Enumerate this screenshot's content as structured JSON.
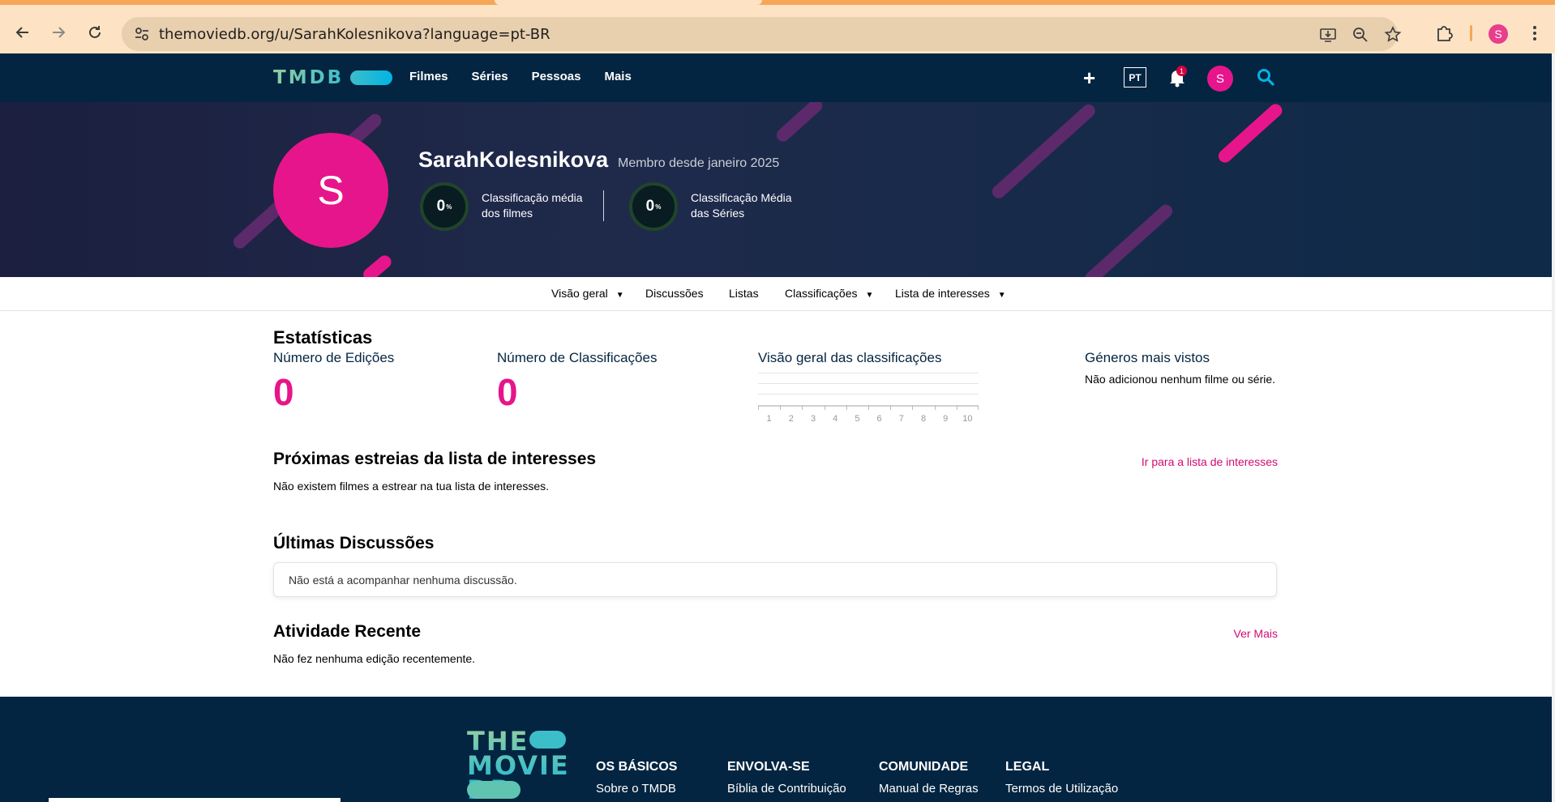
{
  "browser": {
    "url": "themoviedb.org/u/SarahKolesnikova?language=pt-BR",
    "profile_initial": "S"
  },
  "header": {
    "logo": "TMDB",
    "nav": [
      "Filmes",
      "Séries",
      "Pessoas",
      "Mais"
    ],
    "language": "PT",
    "notification_count": "1",
    "avatar_initial": "S"
  },
  "profile": {
    "avatar_initial": "S",
    "username": "SarahKolesnikova",
    "member_since": "Membro desde janeiro 2025",
    "movie_score": "0",
    "movie_score_label_1": "Classificação média",
    "movie_score_label_2": "dos filmes",
    "tv_score": "0",
    "tv_score_label_1": "Classificação Média",
    "tv_score_label_2": "das Séries",
    "score_unit": "%"
  },
  "sub_nav": {
    "overview": "Visão geral",
    "discussions": "Discussões",
    "lists": "Listas",
    "ratings": "Classificações",
    "watchlist": "Lista de interesses"
  },
  "stats": {
    "heading": "Estatísticas",
    "edits_label": "Número de Edições",
    "edits_value": "0",
    "ratings_label": "Número de Classificações",
    "ratings_value": "0",
    "overview_label": "Visão geral das classificações",
    "genres_label": "Géneros mais vistos",
    "genres_text": "Não adicionou nenhum filme ou série."
  },
  "chart_data": {
    "type": "bar",
    "categories": [
      "1",
      "2",
      "3",
      "4",
      "5",
      "6",
      "7",
      "8",
      "9",
      "10"
    ],
    "values": [
      0,
      0,
      0,
      0,
      0,
      0,
      0,
      0,
      0,
      0
    ],
    "title": "Visão geral das classificações"
  },
  "upcoming": {
    "heading": "Próximas estreias da lista de interesses",
    "link": "Ir para a lista de interesses",
    "text": "Não existem filmes a estrear na tua lista de interesses."
  },
  "discussions": {
    "heading": "Últimas Discussões",
    "text": "Não está a acompanhar nenhuma discussão."
  },
  "activity": {
    "heading": "Atividade Recente",
    "link": "Ver Mais",
    "text": "Não fez nenhuma edição recentemente."
  },
  "footer": {
    "logo_lines": [
      "THE",
      "MOVIE",
      "DB"
    ],
    "col1_heading": "OS BÁSICOS",
    "col1_link": "Sobre o TMDB",
    "col2_heading": "ENVOLVA-SE",
    "col2_link": "Bíblia de Contribuição",
    "col3_heading": "COMUNIDADE",
    "col3_link": "Manual de Regras",
    "col4_heading": "LEGAL",
    "col4_link": "Termos de Utilização"
  },
  "colors": {
    "header_bg": "#032541",
    "accent_pink": "#e7158b",
    "link_pink": "#d40a73",
    "chrome_bg": "#fde3c4"
  }
}
